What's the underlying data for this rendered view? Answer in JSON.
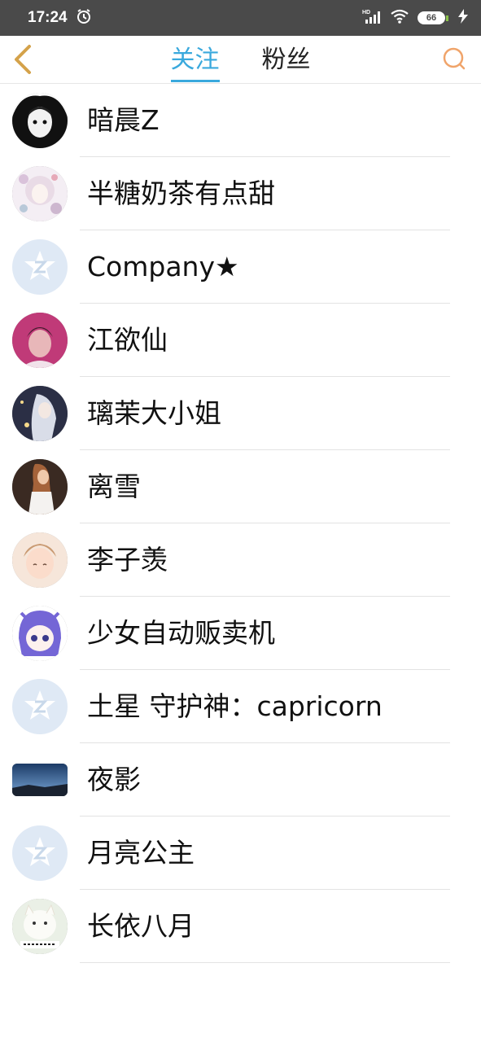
{
  "status_bar": {
    "time": "17:24",
    "battery": "66",
    "icons": [
      "alarm-icon",
      "signal-icon",
      "wifi-icon",
      "battery-icon",
      "charging-icon"
    ]
  },
  "header": {
    "tabs": [
      {
        "label": "关注",
        "active": true
      },
      {
        "label": "粉丝",
        "active": false
      }
    ],
    "accent_color": "#3aa9dd",
    "back_color": "#d4a24a",
    "search_color": "#f0a46a"
  },
  "users": [
    {
      "name": "暗晨Z",
      "avatar": "photo"
    },
    {
      "name": "半糖奶茶有点甜",
      "avatar": "photo"
    },
    {
      "name": "Company★",
      "avatar": "default"
    },
    {
      "name": "江欲仙",
      "avatar": "photo"
    },
    {
      "name": "璃茉大小姐",
      "avatar": "photo"
    },
    {
      "name": "离雪",
      "avatar": "photo"
    },
    {
      "name": "李子羡",
      "avatar": "photo"
    },
    {
      "name": "少女自动贩卖机",
      "avatar": "photo"
    },
    {
      "name": "土星 守护神：capricorn",
      "avatar": "default"
    },
    {
      "name": "夜影",
      "avatar": "photo"
    },
    {
      "name": "月亮公主",
      "avatar": "default"
    },
    {
      "name": "长依八月",
      "avatar": "photo"
    }
  ]
}
